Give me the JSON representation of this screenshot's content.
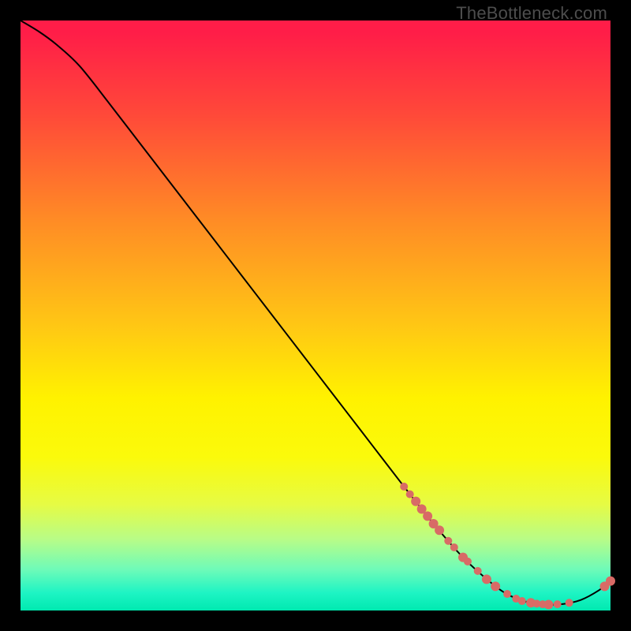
{
  "watermark": "TheBottleneck.com",
  "chart_data": {
    "type": "line",
    "title": "",
    "xlabel": "",
    "ylabel": "",
    "xlim": [
      0,
      100
    ],
    "ylim": [
      0,
      100
    ],
    "grid": false,
    "series": [
      {
        "name": "bottleneck-curve",
        "x": [
          0,
          3,
          6,
          10,
          15,
          20,
          25,
          30,
          35,
          40,
          45,
          50,
          55,
          60,
          65,
          70,
          75,
          80,
          83,
          86,
          89,
          92,
          95,
          98,
          100
        ],
        "y": [
          100,
          98.2,
          96.0,
          92.3,
          86.0,
          79.5,
          73.0,
          66.5,
          60.0,
          53.5,
          47.0,
          40.5,
          34.0,
          27.5,
          21.0,
          14.7,
          9.0,
          4.5,
          2.5,
          1.4,
          1.0,
          1.1,
          1.8,
          3.4,
          5.0
        ]
      }
    ],
    "highlight_points": {
      "name": "dense-region",
      "color": "#d86b66",
      "points": [
        {
          "x": 65.0,
          "y": 21.0,
          "r": 5
        },
        {
          "x": 66.0,
          "y": 19.7,
          "r": 5
        },
        {
          "x": 67.0,
          "y": 18.5,
          "r": 6
        },
        {
          "x": 68.0,
          "y": 17.2,
          "r": 6
        },
        {
          "x": 69.0,
          "y": 16.0,
          "r": 6
        },
        {
          "x": 70.0,
          "y": 14.7,
          "r": 6
        },
        {
          "x": 71.0,
          "y": 13.6,
          "r": 6
        },
        {
          "x": 72.5,
          "y": 11.8,
          "r": 5
        },
        {
          "x": 73.5,
          "y": 10.7,
          "r": 5
        },
        {
          "x": 75.0,
          "y": 9.0,
          "r": 6
        },
        {
          "x": 75.8,
          "y": 8.3,
          "r": 5
        },
        {
          "x": 77.5,
          "y": 6.7,
          "r": 5
        },
        {
          "x": 79.0,
          "y": 5.3,
          "r": 6
        },
        {
          "x": 80.5,
          "y": 4.1,
          "r": 6
        },
        {
          "x": 82.5,
          "y": 2.8,
          "r": 5
        },
        {
          "x": 84.0,
          "y": 2.0,
          "r": 5
        },
        {
          "x": 85.0,
          "y": 1.6,
          "r": 5
        },
        {
          "x": 86.5,
          "y": 1.3,
          "r": 6
        },
        {
          "x": 87.5,
          "y": 1.15,
          "r": 5
        },
        {
          "x": 88.5,
          "y": 1.05,
          "r": 5
        },
        {
          "x": 89.5,
          "y": 1.0,
          "r": 6
        },
        {
          "x": 91.0,
          "y": 1.05,
          "r": 5
        },
        {
          "x": 93.0,
          "y": 1.3,
          "r": 5
        },
        {
          "x": 99.0,
          "y": 4.1,
          "r": 6
        },
        {
          "x": 100.0,
          "y": 5.0,
          "r": 6
        }
      ]
    }
  }
}
